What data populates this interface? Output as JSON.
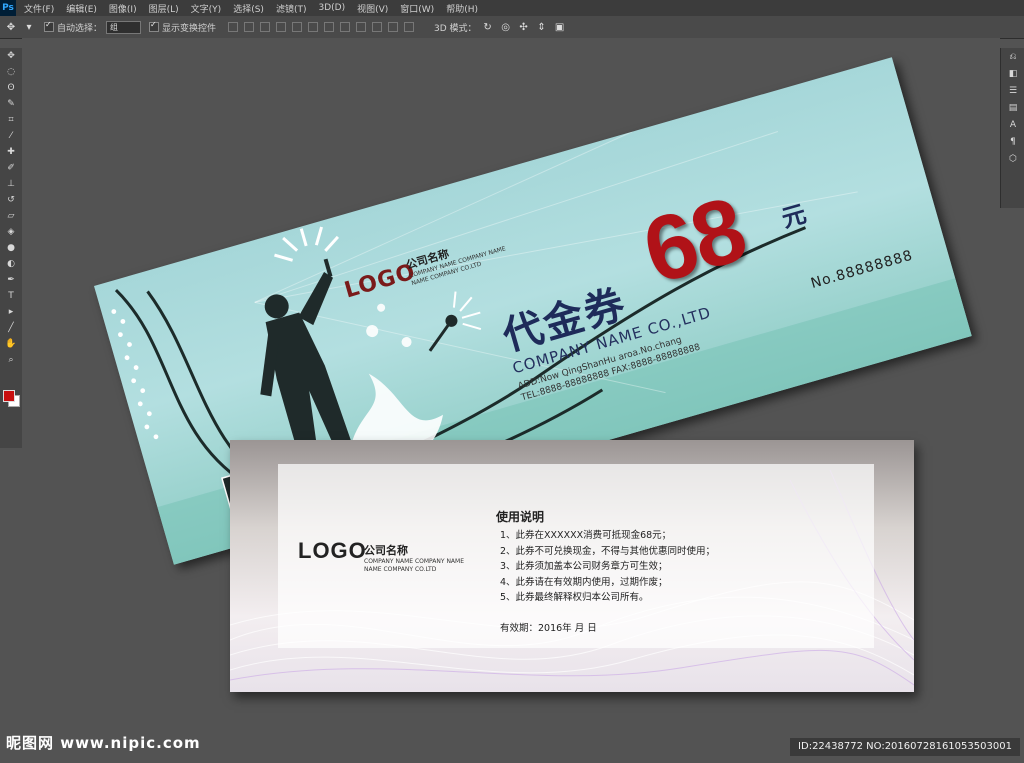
{
  "app": {
    "logo": "Ps"
  },
  "menu": [
    "文件(F)",
    "编辑(E)",
    "图像(I)",
    "图层(L)",
    "文字(Y)",
    "选择(S)",
    "滤镜(T)",
    "3D(D)",
    "视图(V)",
    "窗口(W)",
    "帮助(H)"
  ],
  "options": {
    "auto_select_label": "自动选择：",
    "auto_select_value": "组",
    "show_transform_label": "显示变换控件",
    "mode_3d_label": "3D 模式："
  },
  "card1": {
    "logo": "LOGO",
    "company": "公司名称",
    "company_sub1": "COMPANY NAME COMPANY NAME",
    "company_sub2": "NAME COMPANY CO.LTD",
    "title": "代金券",
    "amount": "68",
    "unit": "元",
    "company_name": "COMPANY NAME CO.,LTD",
    "address": "ADD:Now QingShanHu aroa.No.chang",
    "tel": "TEL:8888-88888888   FAX:8888-88888888",
    "serial": "No.88888888"
  },
  "card2": {
    "logo": "LOGO",
    "company": "公司名称",
    "company_sub1": "COMPANY NAME COMPANY NAME",
    "company_sub2": "NAME COMPANY CO.LTD",
    "heading": "使用说明",
    "rules": [
      "1、此券在XXXXXX消费可抵现金68元；",
      "2、此券不可兑换现金，不得与其他优惠同时使用；",
      "3、此券须加盖本公司财务章方可生效；",
      "4、此券请在有效期内使用，过期作废；",
      "5、此券最终解释权归本公司所有。"
    ],
    "validity": "有效期：2016年    月    日"
  },
  "watermark": {
    "left": "昵图网 www.nipic.com",
    "right": "ID:22438772 NO:20160728161053503001"
  },
  "colors": {
    "accent_red": "#b01218",
    "navy": "#1e2b5a",
    "teal": "#a6d7d9"
  }
}
